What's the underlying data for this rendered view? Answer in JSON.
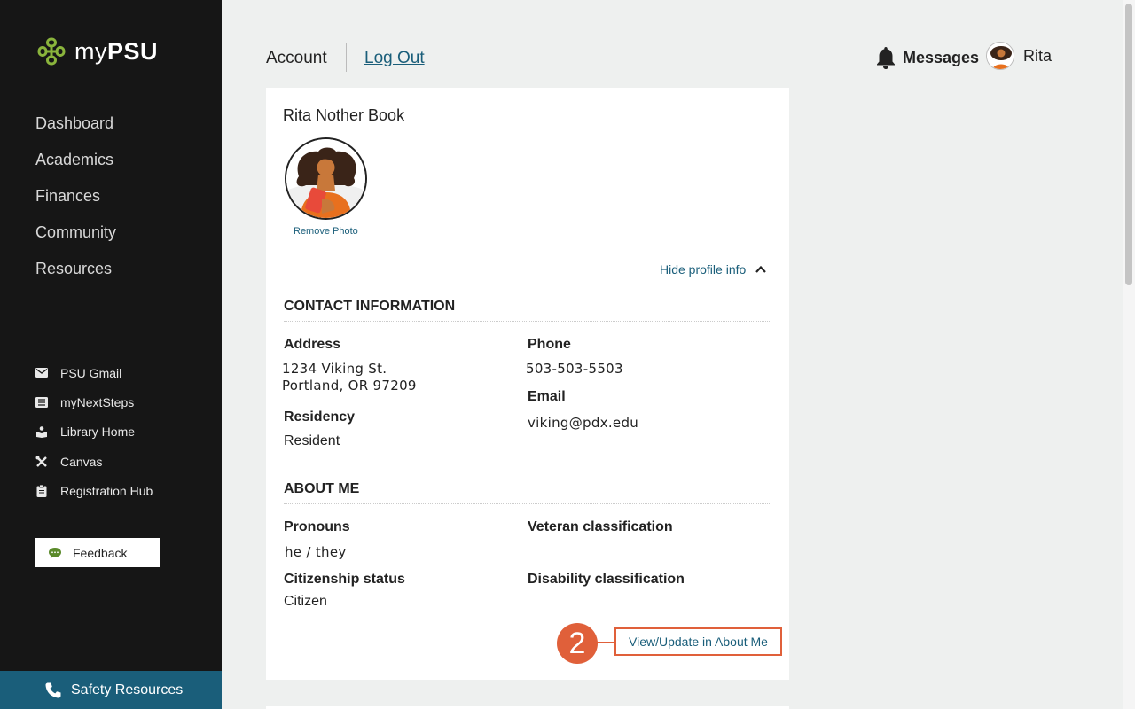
{
  "sidebar": {
    "brand": {
      "prefix": "my",
      "bold": "PSU"
    },
    "nav": [
      {
        "label": "Dashboard"
      },
      {
        "label": "Academics"
      },
      {
        "label": "Finances"
      },
      {
        "label": "Community"
      },
      {
        "label": "Resources"
      }
    ],
    "links": [
      {
        "label": "PSU Gmail",
        "icon": "envelope-icon"
      },
      {
        "label": "myNextSteps",
        "icon": "list-icon"
      },
      {
        "label": "Library Home",
        "icon": "library-icon"
      },
      {
        "label": "Canvas",
        "icon": "tools-icon"
      },
      {
        "label": "Registration Hub",
        "icon": "clipboard-icon"
      }
    ],
    "feedback_label": "Feedback",
    "safety_label": "Safety Resources"
  },
  "topbar": {
    "account_label": "Account",
    "logout_label": "Log Out",
    "messages_label": "Messages",
    "user_name": "Rita"
  },
  "profile": {
    "full_name": "Rita Nother Book",
    "remove_photo_label": "Remove Photo",
    "hide_info_label": "Hide profile info",
    "contact": {
      "title": "CONTACT INFORMATION",
      "address_label": "Address",
      "address_line1": "1234 Viking St.",
      "address_line2": "Portland, OR 97209",
      "phone_label": "Phone",
      "phone": "503-503-5503",
      "email_label": "Email",
      "email": "viking@pdx.edu",
      "residency_label": "Residency",
      "residency": "Resident"
    },
    "about": {
      "title": "ABOUT ME",
      "pronouns_label": "Pronouns",
      "pronouns": "he / they",
      "veteran_label": "Veteran classification",
      "citizenship_label": "Citizenship status",
      "citizenship": "Citizen",
      "disability_label": "Disability classification"
    },
    "update_link_label": "View/Update in About Me",
    "step_marker": "2"
  },
  "colors": {
    "sidebar_bg": "#161616",
    "accent_link": "#1a5e7a",
    "highlight": "#e0603a",
    "brand_green": "#8ab43c"
  }
}
